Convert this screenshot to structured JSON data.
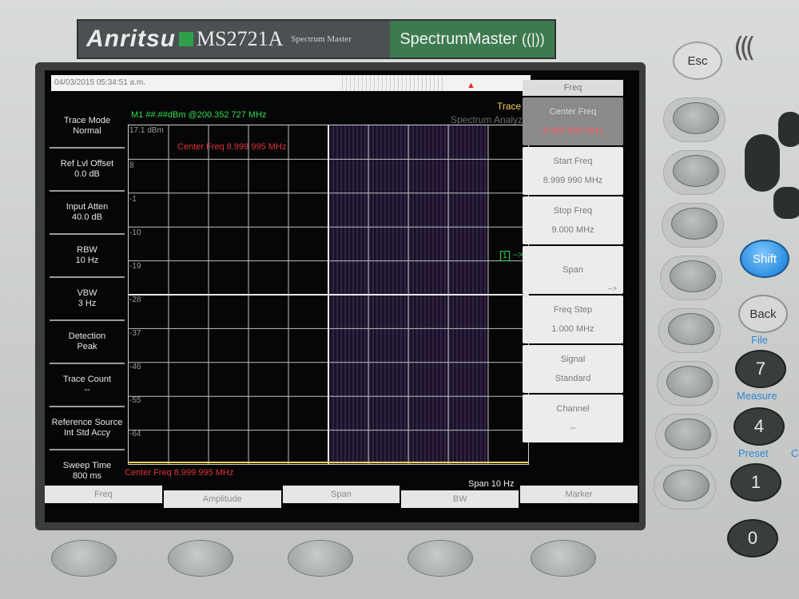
{
  "brand": {
    "name": "Anritsu",
    "model": "MS2721A",
    "sub": "Spectrum Master",
    "right_logo": "SpectrumMaster",
    "antenna_icon": "antenna-icon"
  },
  "status": {
    "datetime": "04/03/2015 05:34:51 a.m.",
    "trace": "Trace A",
    "mode": "Spectrum Analyzer"
  },
  "left_panel": [
    {
      "label": "Trace Mode",
      "value": "Normal"
    },
    {
      "label": "Ref Lvl Offset",
      "value": "0.0 dB"
    },
    {
      "label": "Input Atten",
      "value": "40.0 dB"
    },
    {
      "label": "RBW",
      "value": "10 Hz"
    },
    {
      "label": "VBW",
      "value": "3 Hz"
    },
    {
      "label": "Detection",
      "value": "Peak"
    },
    {
      "label": "Trace Count",
      "value": "--"
    },
    {
      "label": "Reference Source",
      "value": "Int Std Accy"
    },
    {
      "label": "Sweep Time",
      "value": "800 ms"
    }
  ],
  "plot": {
    "marker_readout": "M1 ##.##dBm @200.352 727 MHz",
    "ref_level": "17.1 dBm",
    "y_labels": [
      "8",
      "-1",
      "-10",
      "-19",
      "-28",
      "-37",
      "-46",
      "-55",
      "-64"
    ],
    "center_freq_inline": "Center Freq 8.999 995 MHz",
    "center_freq_bottom": "Center Freq 8.999 995 MHz",
    "span_bottom": "Span 10 Hz",
    "marker_label": "1",
    "marker_arrow": "-->"
  },
  "right_panel": {
    "header": "Freq",
    "keys": [
      {
        "label": "Center Freq",
        "value": "8.999 995 MHz",
        "active": true
      },
      {
        "label": "Start Freq",
        "value": "8.999 990 MHz"
      },
      {
        "label": "Stop Freq",
        "value": "9.000 MHz"
      },
      {
        "label": "Span",
        "value": "",
        "arrow": "-->"
      },
      {
        "label": "Freq Step",
        "value": "1.000 MHz"
      },
      {
        "label": "Signal",
        "value": "Standard"
      },
      {
        "label": "Channel",
        "value": "--"
      }
    ]
  },
  "bottom_tabs": [
    "Freq",
    "Amplitude",
    "Span",
    "BW",
    "Marker"
  ],
  "hardware": {
    "esc": "Esc",
    "shift": "Shift",
    "back": "Back",
    "file_label": "File",
    "measure_label": "Measure",
    "preset_label": "Preset",
    "c_label": "C",
    "num7": "7",
    "num4": "4",
    "num1": "1",
    "num0": "0"
  }
}
